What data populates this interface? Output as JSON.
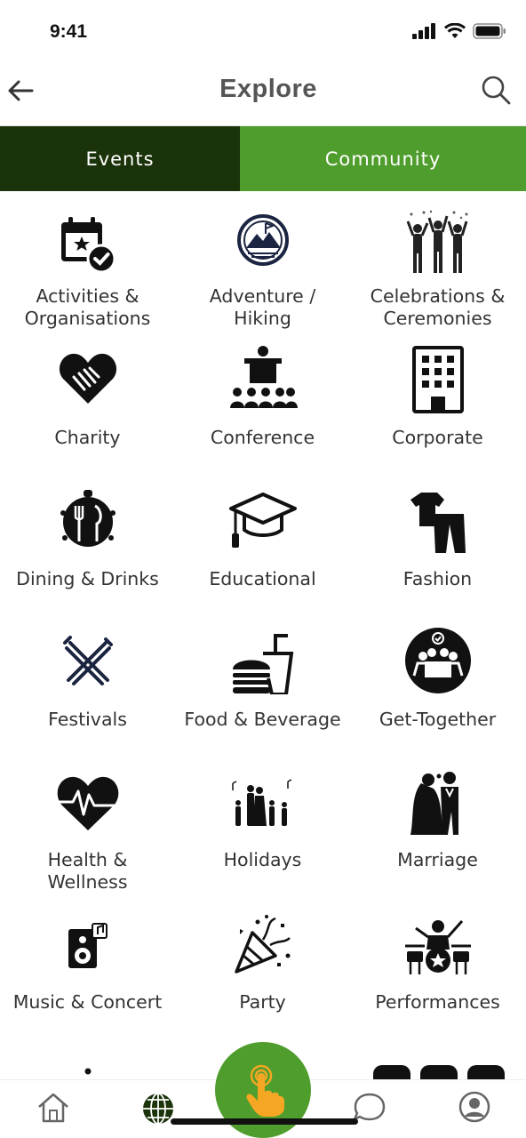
{
  "status": {
    "time": "9:41"
  },
  "header": {
    "title": "Explore"
  },
  "tabs": [
    {
      "label": "Events",
      "active": true
    },
    {
      "label": "Community",
      "active": false
    }
  ],
  "colors": {
    "dark_green": "#1b330a",
    "brand_green": "#4f9d2c",
    "title_gray": "#555555"
  },
  "categories": [
    {
      "label": "Activities & Organisations",
      "icon": "calendar-star-check-icon"
    },
    {
      "label": "Adventure / Hiking",
      "icon": "mountain-badge-icon"
    },
    {
      "label": "Celebrations & Ceremonies",
      "icon": "celebrating-people-icon"
    },
    {
      "label": "Charity",
      "icon": "heart-handshake-icon"
    },
    {
      "label": "Conference",
      "icon": "podium-audience-icon"
    },
    {
      "label": "Corporate",
      "icon": "office-building-icon"
    },
    {
      "label": "Dining & Drinks",
      "icon": "dining-cutlery-icon"
    },
    {
      "label": "Educational",
      "icon": "graduation-cap-icon"
    },
    {
      "label": "Fashion",
      "icon": "clothing-icon"
    },
    {
      "label": "Festivals",
      "icon": "crossed-sticks-icon"
    },
    {
      "label": "Food & Beverage",
      "icon": "burger-drink-icon"
    },
    {
      "label": "Get-Together",
      "icon": "group-meeting-icon"
    },
    {
      "label": "Health & Wellness",
      "icon": "heartbeat-icon"
    },
    {
      "label": "Holidays",
      "icon": "family-walking-icon"
    },
    {
      "label": "Marriage",
      "icon": "bride-groom-icon"
    },
    {
      "label": "Music & Concert",
      "icon": "speaker-music-icon"
    },
    {
      "label": "Party",
      "icon": "party-popper-icon"
    },
    {
      "label": "Performances",
      "icon": "drummer-icon"
    },
    {
      "label": "",
      "icon": "service-bell-icon"
    }
  ],
  "bottom_nav": [
    {
      "name": "home",
      "icon": "home-icon"
    },
    {
      "name": "explore",
      "icon": "globe-icon"
    },
    {
      "name": "tap",
      "icon": "tap-hand-icon"
    },
    {
      "name": "chat",
      "icon": "chat-bubble-icon"
    },
    {
      "name": "profile",
      "icon": "user-circle-icon"
    }
  ]
}
